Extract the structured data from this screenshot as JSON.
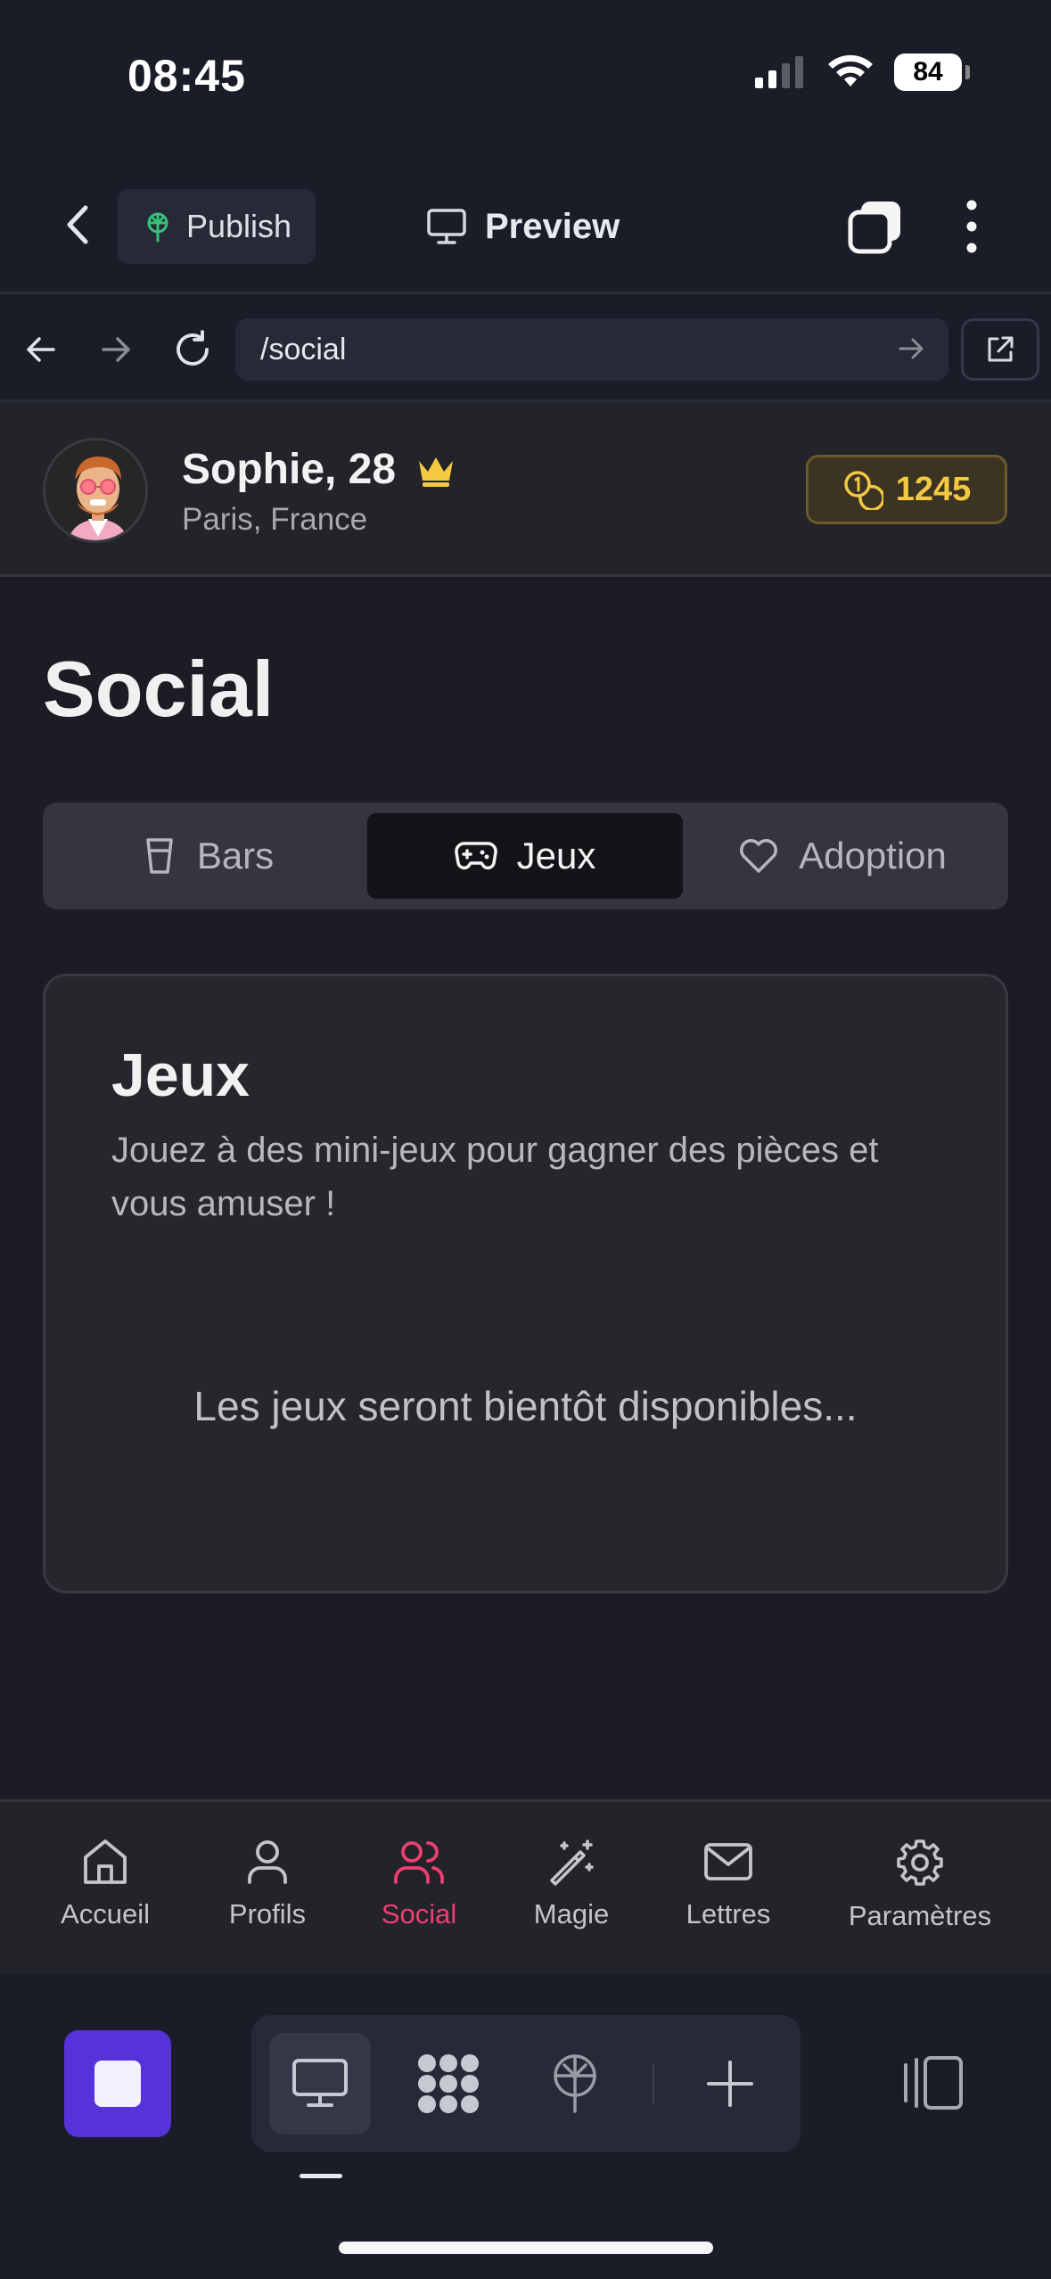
{
  "status": {
    "time": "08:45",
    "battery": "84"
  },
  "header": {
    "publish_label": "Publish",
    "preview_label": "Preview"
  },
  "browser": {
    "url": "/social"
  },
  "profile": {
    "name": "Sophie, 28",
    "location": "Paris, France",
    "coins": "1245"
  },
  "page": {
    "title": "Social"
  },
  "tabs": [
    {
      "label": "Bars",
      "icon": "glass-icon",
      "active": false
    },
    {
      "label": "Jeux",
      "icon": "gamepad-icon",
      "active": true
    },
    {
      "label": "Adoption",
      "icon": "heart-icon",
      "active": false
    }
  ],
  "card": {
    "title": "Jeux",
    "description": "Jouez à des mini-jeux pour gagner des pièces et vous amuser !",
    "empty_message": "Les jeux seront bientôt disponibles..."
  },
  "bottom_nav": [
    {
      "label": "Accueil",
      "icon": "home-icon",
      "active": false
    },
    {
      "label": "Profils",
      "icon": "user-icon",
      "active": false
    },
    {
      "label": "Social",
      "icon": "users-icon",
      "active": true
    },
    {
      "label": "Magie",
      "icon": "magic-wand-icon",
      "active": false
    },
    {
      "label": "Lettres",
      "icon": "mail-icon",
      "active": false
    },
    {
      "label": "Paramètres",
      "icon": "gear-icon",
      "active": false
    }
  ],
  "colors": {
    "accent": "#ec3f72",
    "coins": "#f5c842",
    "stop_button": "#5533d9",
    "background": "#1c1c24"
  }
}
